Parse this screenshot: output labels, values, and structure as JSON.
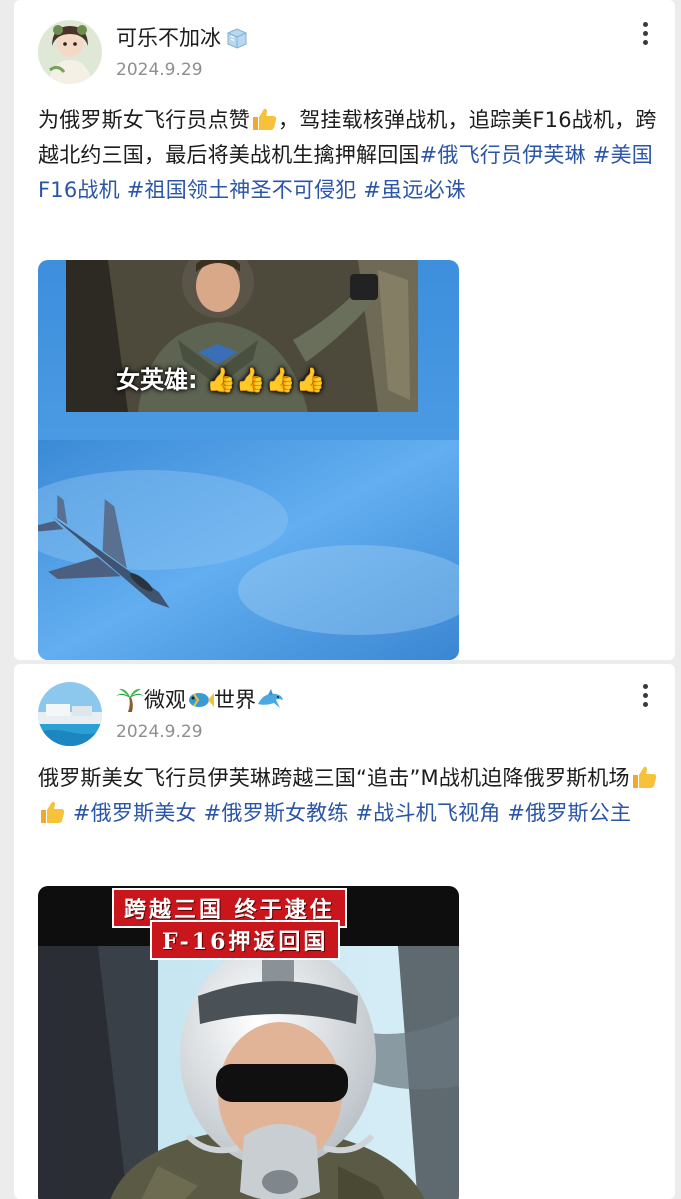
{
  "posts": [
    {
      "username": "可乐不加冰",
      "date": "2024.9.29",
      "text_part1": "为俄罗斯女飞行员点赞",
      "text_part2": "，驾挂载核弹战机，追踪美F16战机，跨越北约三国，最后将美战机生擒押解回国",
      "hashtags": [
        "#俄飞行员伊芙琳",
        "#美国F16战机",
        "#祖国领土神圣不可侵犯",
        "#虽远必诛"
      ],
      "image_caption": "女英雄:",
      "icons": {
        "badge": "ice-cube-icon",
        "more": "more-options-icon"
      }
    },
    {
      "username_emoji1": "palm-tree-icon",
      "username_part1": "微观",
      "username_emoji2": "fish-icon",
      "username_part2": "世界",
      "username_emoji3": "dolphin-icon",
      "date": "2024.9.29",
      "text": "俄罗斯美女飞行员伊芙琳跨越三国“追击”M战机迫降俄罗斯机场",
      "hashtags": [
        "#俄罗斯美女",
        "#俄罗斯女教练",
        "#战斗机飞视角",
        "#俄罗斯公主"
      ],
      "banner_line1": "跨越三国 终于逮住",
      "banner_line2": "F-16押返回国",
      "icons": {
        "more": "more-options-icon"
      }
    }
  ],
  "colors": {
    "hashtag": "#2a55a8",
    "username": "#1c1c1c",
    "date": "#8e8e8e",
    "banner": "#c8161c"
  }
}
